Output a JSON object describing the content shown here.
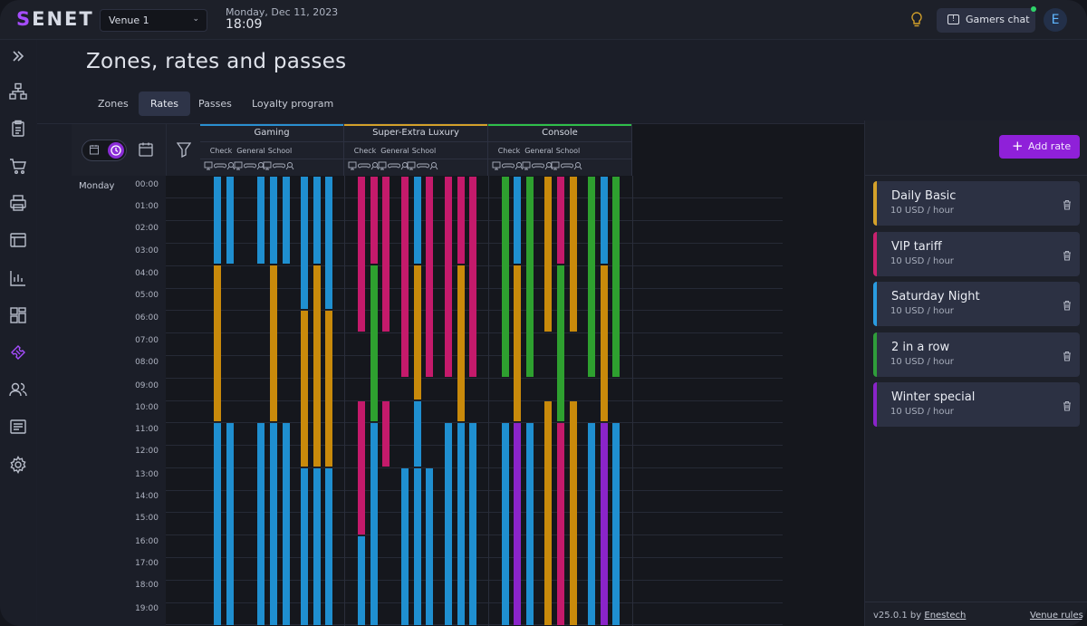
{
  "app": {
    "logo_s": "S",
    "logo_rest": "ENET"
  },
  "venue_select": {
    "value": "Venue 1"
  },
  "datetime": {
    "date": "Monday, Dec 11, 2023",
    "time": "18:09"
  },
  "header": {
    "chat_label": "Gamers chat",
    "avatar_letter": "E"
  },
  "page": {
    "title": "Zones, rates and passes"
  },
  "tabs": [
    {
      "label": "Zones",
      "active": false
    },
    {
      "label": "Rates",
      "active": true
    },
    {
      "label": "Passes",
      "active": false
    },
    {
      "label": "Loyalty program",
      "active": false
    }
  ],
  "schedule": {
    "day": "Monday",
    "hours": [
      "00:00",
      "01:00",
      "02:00",
      "03:00",
      "04:00",
      "05:00",
      "06:00",
      "07:00",
      "08:00",
      "09:00",
      "10:00",
      "11:00",
      "12:00",
      "13:00",
      "14:00",
      "15:00",
      "16:00",
      "17:00",
      "18:00",
      "19:00"
    ],
    "zones": [
      {
        "name": "Gaming",
        "color": "#2a8fd0",
        "subzones": [
          "Check",
          "General",
          "School"
        ]
      },
      {
        "name": "Super-Extra Luxury",
        "color": "#d4a12a",
        "subzones": [
          "Check",
          "General",
          "School"
        ]
      },
      {
        "name": "Console",
        "color": "#2fbf4a",
        "subzones": [
          "Check",
          "General",
          "School"
        ]
      }
    ],
    "device_icons": [
      "pc",
      "gamepad",
      "vr"
    ]
  },
  "rates_panel": {
    "add_label": "Add rate",
    "rates": [
      {
        "name": "Daily Basic",
        "price": "10 USD / hour",
        "color": "#d4a12a"
      },
      {
        "name": "VIP tariff",
        "price": "10 USD / hour",
        "color": "#c9216e"
      },
      {
        "name": "Saturday Night",
        "price": "10 USD / hour",
        "color": "#2a9be0"
      },
      {
        "name": "2 in a row",
        "price": "10 USD / hour",
        "color": "#2f9d3a"
      },
      {
        "name": "Winter special",
        "price": "10 USD / hour",
        "color": "#8a24c9"
      }
    ]
  },
  "footer": {
    "version": "v25.0.1",
    "by": "by",
    "company": "Enestech",
    "venue_rules": "Venue rules"
  },
  "colors": {
    "accent": "#8f20d9",
    "blue": "#1f8fd0",
    "orange": "#c98a0b",
    "magenta": "#c41a6b",
    "green": "#2ea02f",
    "purple": "#8a24c9"
  }
}
